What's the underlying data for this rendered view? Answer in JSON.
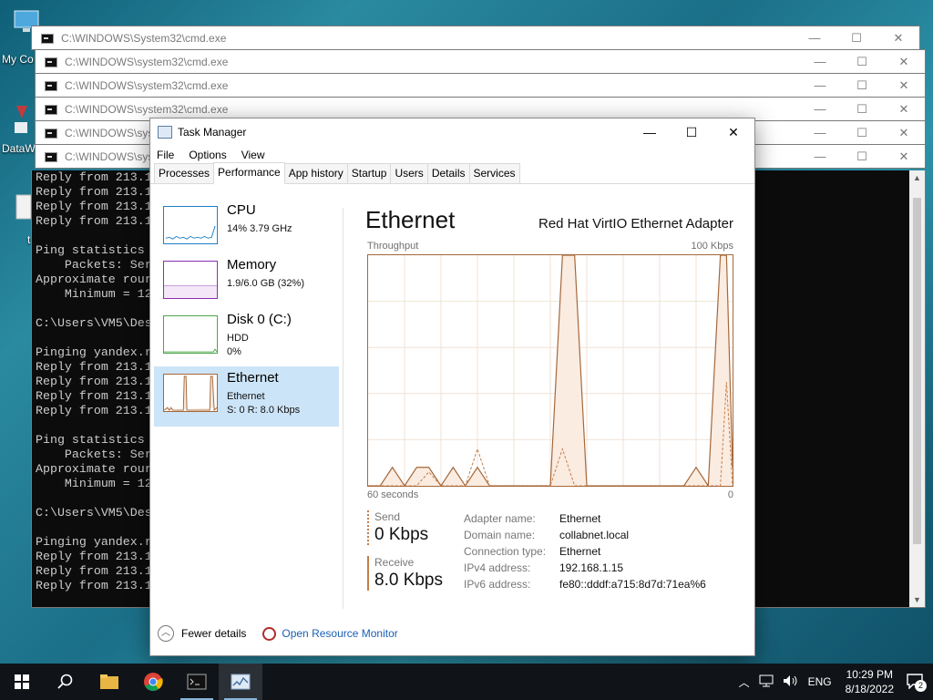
{
  "desktop": {
    "icons": [
      {
        "label": "My Co"
      },
      {
        "label": "DataW"
      },
      {
        "label": "t"
      }
    ]
  },
  "cmd_windows": {
    "titles": [
      "C:\\WINDOWS\\System32\\cmd.exe",
      "C:\\WINDOWS\\system32\\cmd.exe",
      "C:\\WINDOWS\\system32\\cmd.exe",
      "C:\\WINDOWS\\system32\\cmd.exe",
      "C:\\WINDOWS\\sys",
      "C:\\WINDOWS\\sys"
    ],
    "controls": {
      "minimize": "—",
      "maximize": "☐",
      "close": "✕"
    }
  },
  "console": {
    "text": "Reply from 213.1\nReply from 213.1\nReply from 213.1\nReply from 213.1\n\nPing statistics\n    Packets: Ser\nApproximate rour\n    Minimum = 12\n\nC:\\Users\\VM5\\Des\n\nPinging yandex.r\nReply from 213.1\nReply from 213.1\nReply from 213.1\nReply from 213.1\n\nPing statistics\n    Packets: Ser\nApproximate rour\n    Minimum = 12\n\nC:\\Users\\VM5\\Des\n\nPinging yandex.r\nReply from 213.1\nReply from 213.1\nReply from 213.1"
  },
  "task_manager": {
    "title": "Task Manager",
    "controls": {
      "minimize": "—",
      "maximize": "☐",
      "close": "✕"
    },
    "menu": [
      "File",
      "Options",
      "View"
    ],
    "tabs": [
      "Processes",
      "Performance",
      "App history",
      "Startup",
      "Users",
      "Details",
      "Services"
    ],
    "active_tab": "Performance",
    "left": {
      "cpu": {
        "name": "CPU",
        "sub1": "14%  3.79 GHz",
        "color": "#1e7fc7"
      },
      "memory": {
        "name": "Memory",
        "sub1": "1.9/6.0 GB (32%)",
        "color": "#8b2fb0"
      },
      "disk": {
        "name": "Disk 0 (C:)",
        "sub1": "HDD",
        "sub2": "0%",
        "color": "#4ca64c"
      },
      "ethernet": {
        "name": "Ethernet",
        "sub1": "Ethernet",
        "sub2": "S: 0  R: 8.0 Kbps",
        "color": "#a5683b"
      }
    },
    "right": {
      "heading": "Ethernet",
      "adapter": "Red Hat VirtIO Ethernet Adapter",
      "throughput_label": "Throughput",
      "max_label": "100 Kbps",
      "time_label": "60 seconds",
      "zero_label": "0",
      "send_label": "Send",
      "send_value": "0 Kbps",
      "receive_label": "Receive",
      "receive_value": "8.0 Kbps",
      "details": [
        {
          "k": "Adapter name:",
          "v": "Ethernet"
        },
        {
          "k": "Domain name:",
          "v": "collabnet.local"
        },
        {
          "k": "Connection type:",
          "v": "Ethernet"
        },
        {
          "k": "IPv4 address:",
          "v": "192.168.1.15"
        },
        {
          "k": "IPv6 address:",
          "v": "fe80::dddf:a715:8d7d:71ea%6"
        }
      ]
    },
    "footer": {
      "fewer": "Fewer details",
      "resmon": "Open Resource Monitor"
    }
  },
  "chart_data": {
    "type": "area",
    "title": "Throughput",
    "ylim": [
      0,
      100
    ],
    "x": [
      60,
      58,
      56,
      54,
      52,
      50,
      48,
      46,
      44,
      42,
      40,
      38,
      36,
      34,
      32,
      30,
      28,
      26,
      24,
      22,
      20,
      18,
      16,
      14,
      12,
      10,
      8,
      6,
      4,
      2,
      1,
      0
    ],
    "series": [
      {
        "values": [
          0,
          0,
          8,
          0,
          8,
          8,
          0,
          8,
          0,
          8,
          0,
          0,
          0,
          0,
          0,
          0,
          100,
          100,
          0,
          0,
          0,
          0,
          0,
          0,
          0,
          0,
          0,
          8,
          0,
          100,
          100,
          8
        ]
      },
      {
        "values": [
          0,
          0,
          0,
          0,
          0,
          6,
          0,
          0,
          0,
          16,
          0,
          0,
          0,
          0,
          0,
          0,
          16,
          0,
          0,
          0,
          0,
          0,
          0,
          0,
          0,
          0,
          0,
          0,
          0,
          0,
          45,
          0
        ]
      }
    ],
    "grid": true
  },
  "taskbar": {
    "tray": {
      "lang": "ENG",
      "time": "10:29 PM",
      "date": "8/18/2022",
      "notifications": "2"
    }
  }
}
